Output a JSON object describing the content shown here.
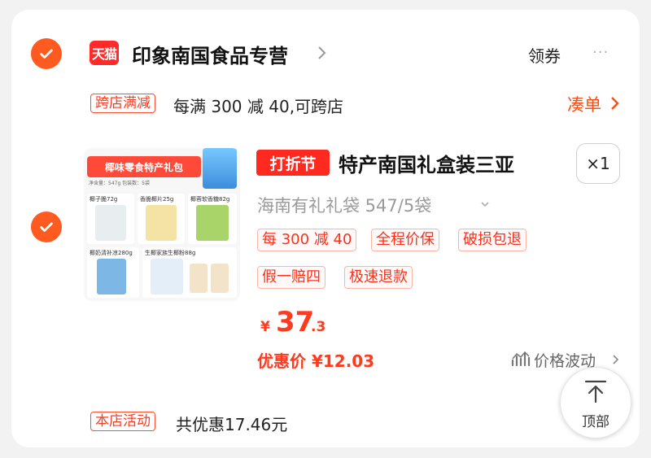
{
  "store": {
    "logo_text": "天猫",
    "name": "印象南国食品专营",
    "coupon_label": "领券",
    "more_label": "···"
  },
  "promo": {
    "tag": "跨店满减",
    "text": "每满 300 减 40,可跨店",
    "bundle_label": "凑单"
  },
  "product": {
    "image": {
      "banner": "椰味零食特产礼包",
      "sub": "净含量：547g  包装数：5袋",
      "items": [
        "椰子脆72g",
        "香脆椰片25g",
        "椰蓉软香糖82g",
        "椰奶清补凉280g",
        "生椰家族生椰粉88g"
      ]
    },
    "sale_badge": "打折节",
    "title": "特产南国礼盒装三亚",
    "quantity": "×1",
    "sku": "海南有礼礼袋 547/5袋",
    "services": [
      "每 300 减 40",
      "全程价保",
      "破损包退",
      "假一赔四",
      "极速退款"
    ],
    "price": {
      "symbol": "¥",
      "integer": "37",
      "decimal": ".3"
    },
    "deal_price": "优惠价 ¥12.03",
    "price_trend_label": "价格波动"
  },
  "footer": {
    "tag": "本店活动",
    "total_text": "共优惠17.46元",
    "top_button_label": "顶部"
  },
  "colors": {
    "accent": "#ff3b1f",
    "check": "#ff5a1f",
    "tmall": "#ff2b2b"
  }
}
